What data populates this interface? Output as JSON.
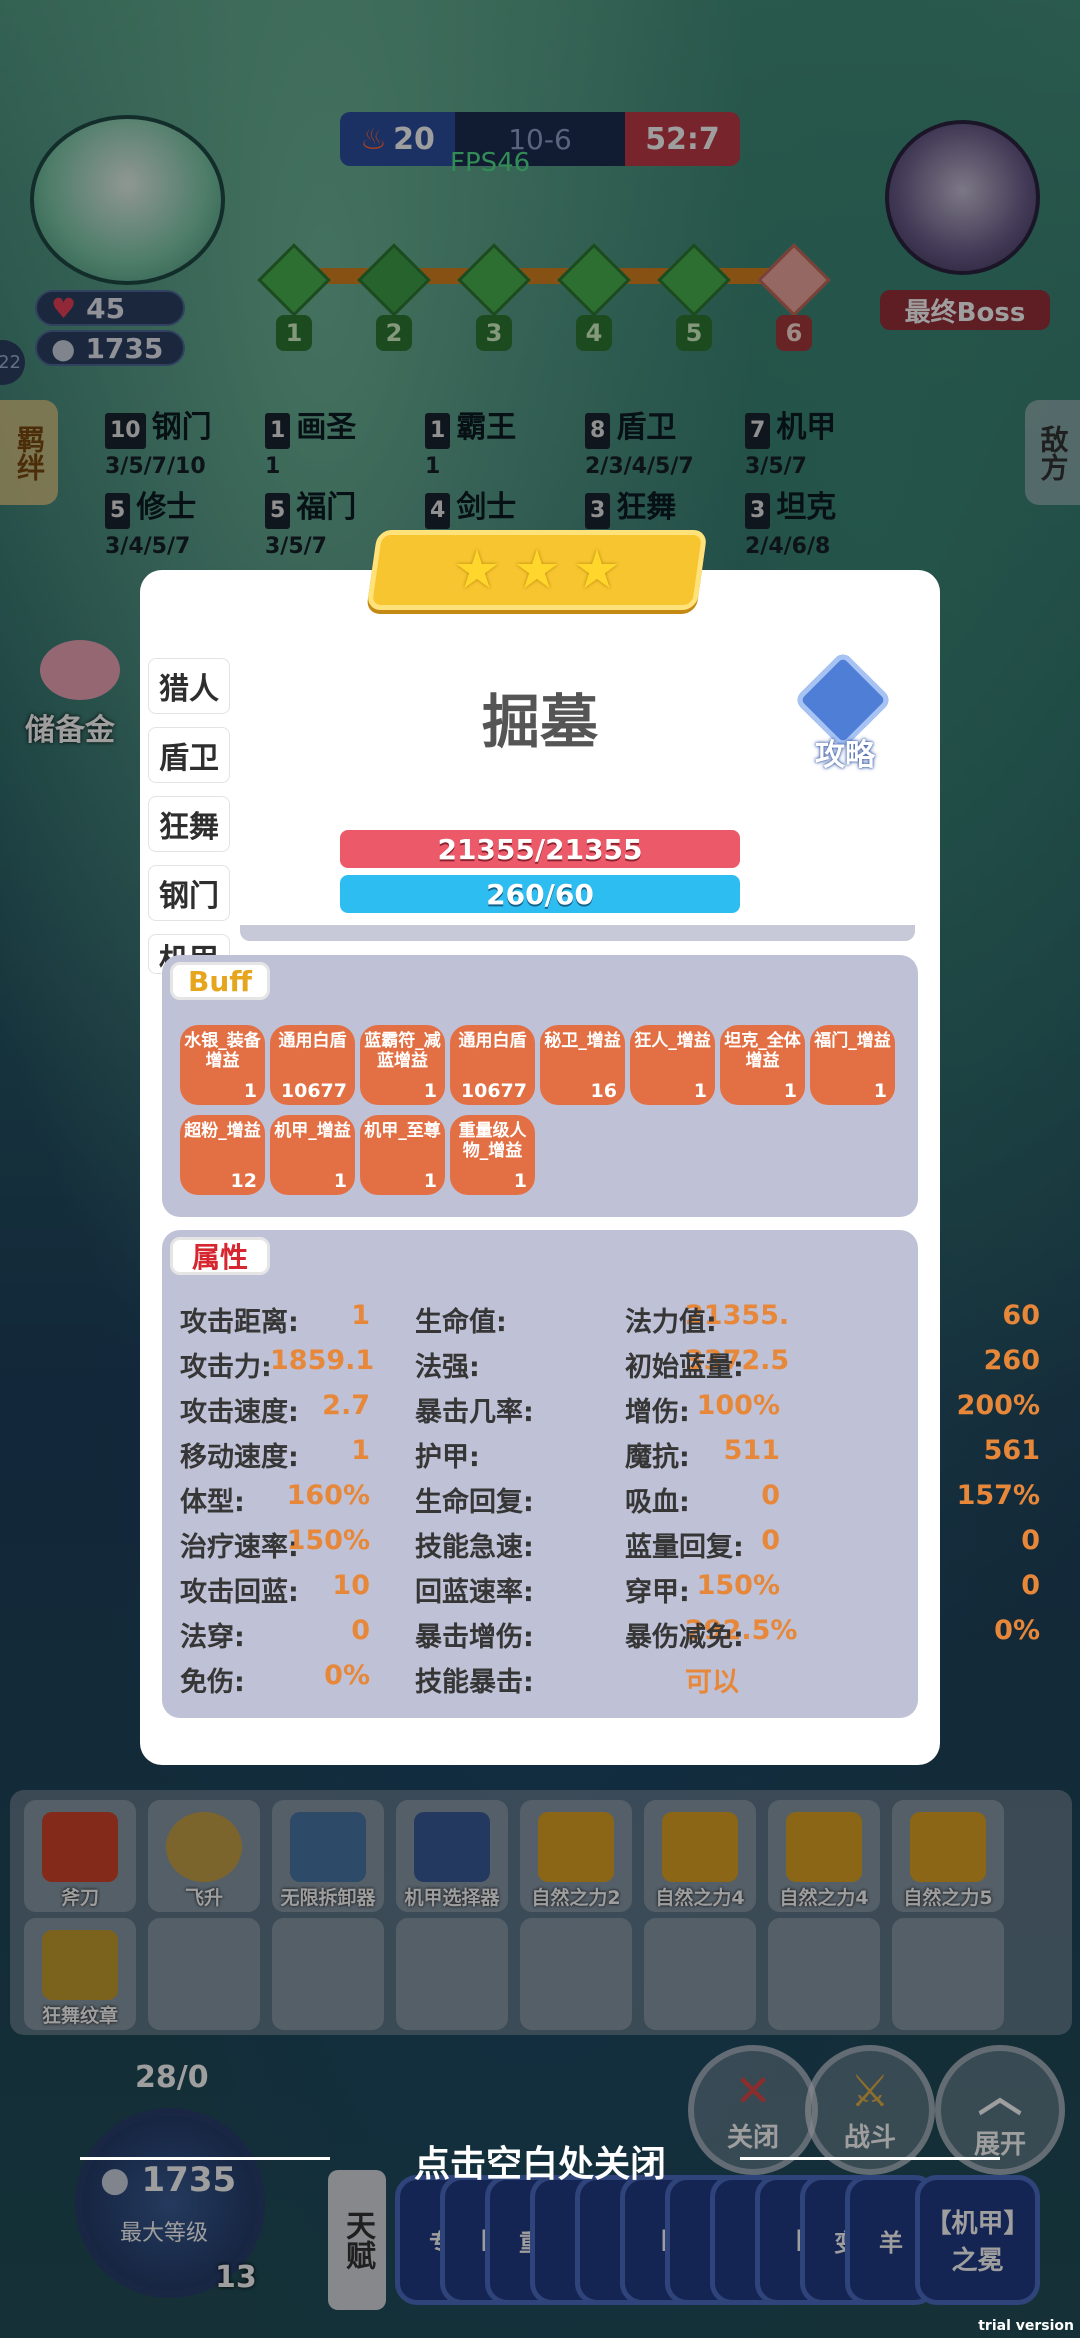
{
  "hud": {
    "player_hp": "45",
    "player_gold": "1735",
    "side_level": "22",
    "score_left": "20",
    "score_mid": "10-6",
    "score_right": "52:7",
    "fps": "FPS46",
    "round_nodes": [
      "1",
      "2",
      "3",
      "4",
      "5",
      "6"
    ],
    "boss_label": "最终Boss"
  },
  "traits": [
    {
      "count": "10",
      "name": "钢门",
      "levels": "3/5/7/10"
    },
    {
      "count": "1",
      "name": "画圣",
      "levels": "1"
    },
    {
      "count": "1",
      "name": "霸王",
      "levels": "1"
    },
    {
      "count": "8",
      "name": "盾卫",
      "levels": "2/3/4/5/7"
    },
    {
      "count": "7",
      "name": "机甲",
      "levels": "3/5/7"
    },
    {
      "count": "5",
      "name": "修士",
      "levels": "3/4/5/7"
    },
    {
      "count": "5",
      "name": "福门",
      "levels": "3/5/7"
    },
    {
      "count": "4",
      "name": "剑士",
      "levels": ""
    },
    {
      "count": "3",
      "name": "狂舞",
      "levels": ""
    },
    {
      "count": "3",
      "name": "坦克",
      "levels": "2/4/6/8"
    }
  ],
  "side_tabs": {
    "left": "羁绊",
    "right": "敌方",
    "reserve": "储备金"
  },
  "unit": {
    "name": "掘墓",
    "stars": 3,
    "guide_label": "攻略",
    "hp": "21355/21355",
    "mp": "260/60",
    "trait_tabs": [
      "猎人",
      "盾卫",
      "狂舞",
      "钢门",
      "机甲"
    ]
  },
  "buff_panel": {
    "title": "Buff",
    "buffs": [
      {
        "name": "水银_装备增益",
        "value": "1"
      },
      {
        "name": "通用白盾",
        "value": "10677"
      },
      {
        "name": "蓝霸符_减蓝增益",
        "value": "1"
      },
      {
        "name": "通用白盾",
        "value": "10677"
      },
      {
        "name": "秘卫_增益",
        "value": "16"
      },
      {
        "name": "狂人_增益",
        "value": "1"
      },
      {
        "name": "坦克_全体增益",
        "value": "1"
      },
      {
        "name": "福门_增益",
        "value": "1"
      },
      {
        "name": "超粉_增益",
        "value": "12"
      },
      {
        "name": "机甲_增益",
        "value": "1"
      },
      {
        "name": "机甲_至尊",
        "value": "1"
      },
      {
        "name": "重量级人物_增益",
        "value": "1"
      }
    ]
  },
  "attr_panel": {
    "title": "属性",
    "rows": [
      [
        {
          "k": "攻击距离:",
          "v": "1"
        },
        {
          "k": "生命值:",
          "v": "21355."
        },
        {
          "k": "法力值:",
          "v": "60"
        }
      ],
      [
        {
          "k": "攻击力:",
          "v": "1859.1"
        },
        {
          "k": "法强:",
          "v": "3372.5"
        },
        {
          "k": "初始蓝量:",
          "v": "260"
        }
      ],
      [
        {
          "k": "攻击速度:",
          "v": "2.7"
        },
        {
          "k": "暴击几率:",
          "v": "100%"
        },
        {
          "k": "增伤:",
          "v": "200%"
        }
      ],
      [
        {
          "k": "移动速度:",
          "v": "1"
        },
        {
          "k": "护甲:",
          "v": "511"
        },
        {
          "k": "魔抗:",
          "v": "561"
        }
      ],
      [
        {
          "k": "体型:",
          "v": "160%"
        },
        {
          "k": "生命回复:",
          "v": "0"
        },
        {
          "k": "吸血:",
          "v": "157%"
        }
      ],
      [
        {
          "k": "治疗速率:",
          "v": "150%"
        },
        {
          "k": "技能急速:",
          "v": "0"
        },
        {
          "k": "蓝量回复:",
          "v": "0"
        }
      ],
      [
        {
          "k": "攻击回蓝:",
          "v": "10"
        },
        {
          "k": "回蓝速率:",
          "v": "150%"
        },
        {
          "k": "穿甲:",
          "v": "0"
        }
      ],
      [
        {
          "k": "法穿:",
          "v": "0"
        },
        {
          "k": "暴击增伤:",
          "v": "292.5%"
        },
        {
          "k": "暴伤减免:",
          "v": "0%"
        }
      ],
      [
        {
          "k": "免伤:",
          "v": "0%"
        },
        {
          "k": "技能暴击:",
          "v": "可以"
        }
      ]
    ]
  },
  "items": [
    {
      "label": "斧刀",
      "color": "#d4452a"
    },
    {
      "label": "飞升",
      "color": "#c9a24a"
    },
    {
      "label": "无限拆卸器",
      "color": "#4a78a8"
    },
    {
      "label": "机甲选择器",
      "color": "#3a5c9a"
    },
    {
      "label": "自然之力2",
      "color": "#e0a526"
    },
    {
      "label": "自然之力4",
      "color": "#e0a526"
    },
    {
      "label": "自然之力4",
      "color": "#e0a526"
    },
    {
      "label": "自然之力5",
      "color": "#e0a526"
    },
    {
      "label": "狂舞纹章",
      "color": "#c9a030"
    }
  ],
  "actions": {
    "close": "关闭",
    "fight": "战斗",
    "expand": "展开"
  },
  "close_hint": "点击空白处关闭",
  "level": {
    "xp": "28/0",
    "gold": "1735",
    "max_label": "最大等级",
    "lvl": "13"
  },
  "talent_label": "天赋",
  "cards": [
    "专",
    "[",
    "重",
    "",
    "",
    "[",
    "",
    "",
    "[",
    "变",
    "羊",
    "【机甲】之冕"
  ],
  "watermark": "trial version"
}
